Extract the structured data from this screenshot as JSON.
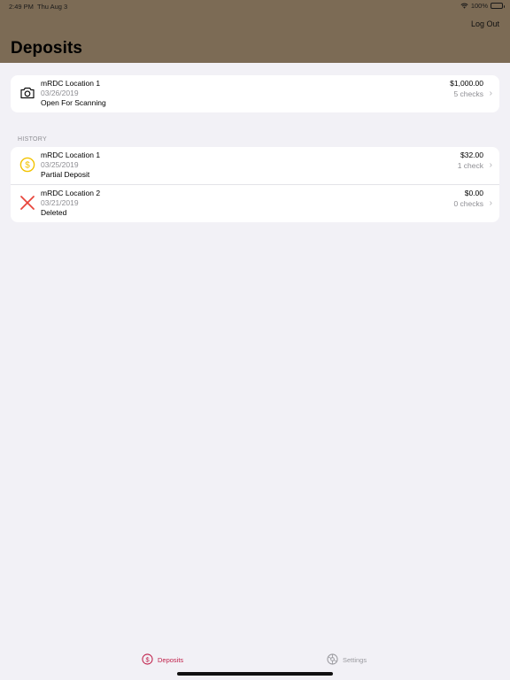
{
  "status_bar": {
    "time": "2:49 PM",
    "date": "Thu Aug 3",
    "battery": "100%"
  },
  "header": {
    "title": "Deposits",
    "logout_label": "Log Out",
    "bg_color": "#7c6b55"
  },
  "current": {
    "title": "mRDC Location 1",
    "date": "03/26/2019",
    "status": "Open For Scanning",
    "amount": "$1,000.00",
    "checks": "5 checks",
    "icon": "camera-icon"
  },
  "history": {
    "section_label": "HISTORY",
    "rows": [
      {
        "title": "mRDC Location 1",
        "date": "03/25/2019",
        "status": "Partial Deposit",
        "amount": "$32.00",
        "checks": "1 check",
        "icon": "dollar-coin-icon"
      },
      {
        "title": "mRDC Location 2",
        "date": "03/21/2019",
        "status": "Deleted",
        "amount": "$0.00",
        "checks": "0 checks",
        "icon": "x-mark-icon"
      }
    ]
  },
  "tabs": {
    "deposits_label": "Deposits",
    "settings_label": "Settings",
    "active_color": "#c0204a",
    "inactive_color": "#9a9a9f"
  }
}
